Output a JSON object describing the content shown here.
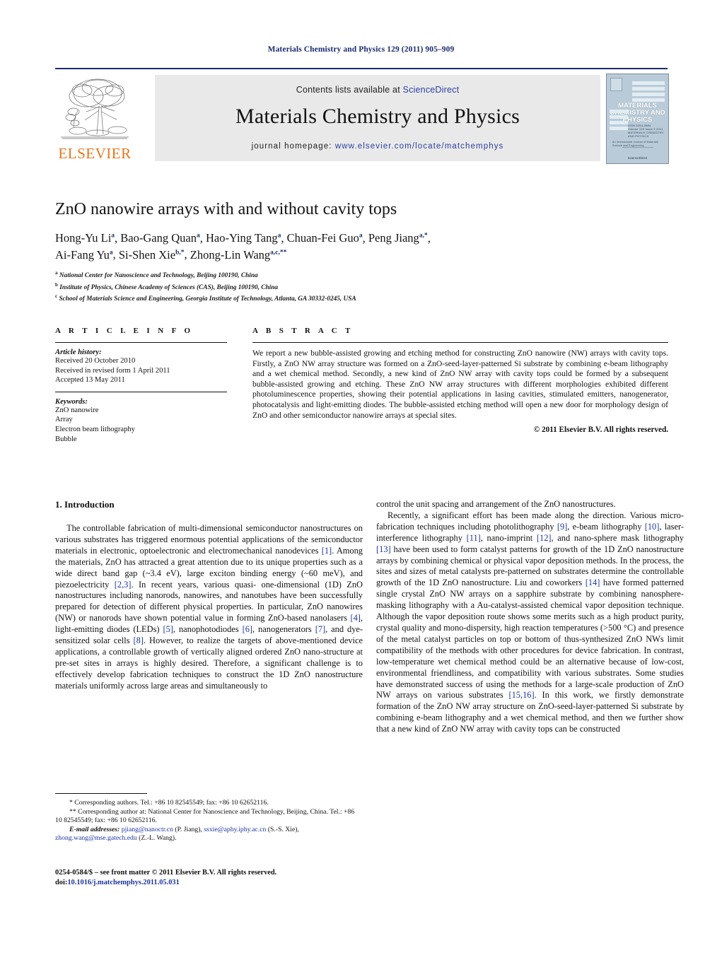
{
  "running_head": "Materials Chemistry and Physics 129 (2011) 905–909",
  "masthead": {
    "contents_prefix": "Contents lists available at ",
    "sciencedirect": "ScienceDirect",
    "journal_name": "Materials Chemistry and Physics",
    "homepage_prefix": "journal homepage: ",
    "homepage_url": "www.elsevier.com/locate/matchemphys",
    "publisher_wordmark": "ELSEVIER",
    "accent_link_color": "#2b3fa0",
    "elsevier_orange": "#E8761B",
    "rule_color": "#1c2b6b"
  },
  "cover": {
    "title_line1": "MATERIALS",
    "title_line2": "CHEMISTRY AND",
    "title_line3": "PHYSICS",
    "sub_line1": "ISSN 0254-0584",
    "sub_line2": "Volume 129 Issue 3 2011",
    "sub_line3": "MATERIALS CHEMISTRY",
    "sub_line4": "AND PHYSICS",
    "caption": "An International Journal of Materials Science and Engineering",
    "foot": "ScienceDirect",
    "background_color": "#b9cbd8"
  },
  "article": {
    "title": "ZnO nanowire arrays with and without cavity tops",
    "authors": [
      {
        "name": "Hong-Yu Li",
        "sup": "a",
        "sep": ", "
      },
      {
        "name": "Bao-Gang Quan",
        "sup": "a",
        "sep": ", "
      },
      {
        "name": "Hao-Ying Tang",
        "sup": "a",
        "sep": ", "
      },
      {
        "name": "Chuan-Fei Guo",
        "sup": "a",
        "sep": ", "
      },
      {
        "name": "Peng Jiang",
        "sup": "a,*",
        "sep": ","
      },
      {
        "name": "Ai-Fang Yu",
        "sup": "a",
        "sep": ", "
      },
      {
        "name": "Si-Shen Xie",
        "sup": "b,*",
        "sep": ", "
      },
      {
        "name": "Zhong-Lin Wang",
        "sup": "a,c,**",
        "sep": ""
      }
    ],
    "affiliations": [
      {
        "mark": "a",
        "text": "National Center for Nanoscience and Technology, Beijing 100190, China"
      },
      {
        "mark": "b",
        "text": "Institute of Physics, Chinese Academy of Sciences (CAS), Beijing 100190, China"
      },
      {
        "mark": "c",
        "text": "School of Materials Science and Engineering, Georgia Institute of Technology, Atlanta, GA 30332-0245, USA"
      }
    ]
  },
  "article_info": {
    "heading": "A R T I C L E   I N F O",
    "history_label": "Article history:",
    "history": [
      "Received 20 October 2010",
      "Received in revised form 1 April 2011",
      "Accepted 13 May 2011"
    ],
    "keywords_label": "Keywords:",
    "keywords": [
      "ZnO nanowire",
      "Array",
      "Electron beam lithography",
      "Bubble"
    ]
  },
  "abstract": {
    "heading": "A B S T R A C T",
    "text": "We report a new bubble-assisted growing and etching method for constructing ZnO nanowire (NW) arrays with cavity tops. Firstly, a ZnO NW array structure was formed on a ZnO-seed-layer-patterned Si substrate by combining e-beam lithography and a wet chemical method. Secondly, a new kind of ZnO NW array with cavity tops could be formed by a subsequent bubble-assisted growing and etching. These ZnO NW array structures with different morphologies exhibited different photoluminescence properties, showing their potential applications in lasing cavities, stimulated emitters, nanogenerator, photocatalysis and light-emitting diodes. The bubble-assisted etching method will open a new door for morphology design of ZnO and other semiconductor nanowire arrays at special sites.",
    "copyright": "© 2011 Elsevier B.V. All rights reserved."
  },
  "body": {
    "section_number_title": "1. Introduction",
    "left_par1_a": "The controllable fabrication of multi-dimensional semiconductor nanostructures on various substrates has triggered enormous potential applications of the semiconductor materials in electronic, optoelectronic and electromechanical nanodevices ",
    "left_ref1": "[1]",
    "left_par1_b": ". Among the materials, ZnO has attracted a great attention due to its unique properties such as a wide direct band gap (~3.4 eV), large exciton binding energy (~60 meV), and piezoelectricity ",
    "left_ref23": "[2,3]",
    "left_par1_c": ". In recent years, various quasi- one-dimensional (1D) ZnO nanostructures including nanorods, nanowires, and nanotubes have been successfully prepared for detection of different physical properties. In particular, ZnO nanowires (NW) or nanorods have shown potential value in forming ZnO-based nanolasers ",
    "left_ref4": "[4]",
    "left_par1_d": ", light-emitting diodes (LEDs) ",
    "left_ref5": "[5]",
    "left_par1_e": ", nanophotodiodes ",
    "left_ref6": "[6]",
    "left_par1_f": ", nanogenerators ",
    "left_ref7": "[7]",
    "left_par1_g": ", and dye-sensitized solar cells ",
    "left_ref8": "[8]",
    "left_par1_h": ". However, to realize the targets of above-mentioned device applications, a controllable growth of vertically aligned ordered ZnO nano-structure at pre-set sites in arrays is highly desired. Therefore, a significant challenge is to effectively develop fabrication techniques to construct the 1D ZnO nanostructure materials uniformly across large areas and simultaneously to",
    "right_par_cont": "control the unit spacing and arrangement of the ZnO nanostructures.",
    "right_par2_a": "Recently, a significant effort has been made along the direction. Various micro-fabrication techniques including photolithography ",
    "right_ref9": "[9]",
    "right_par2_b": ", e-beam lithography ",
    "right_ref10": "[10]",
    "right_par2_c": ", laser-interference lithography ",
    "right_ref11": "[11]",
    "right_par2_d": ", nano-imprint ",
    "right_ref12": "[12]",
    "right_par2_e": ", and nano-sphere mask lithography ",
    "right_ref13": "[13]",
    "right_par2_f": " have been used to form catalyst patterns for growth of the 1D ZnO nanostructure arrays by combining chemical or physical vapor deposition methods. In the process, the sites and sizes of metal catalysts pre-patterned on substrates determine the controllable growth of the 1D ZnO nanostructure. Liu and coworkers ",
    "right_ref14": "[14]",
    "right_par2_g": " have formed patterned single crystal ZnO NW arrays on a sapphire substrate by combining nanosphere-masking lithography with a Au-catalyst-assisted chemical vapor deposition technique. Although the vapor deposition route shows some merits such as a high product purity, crystal quality and mono-dispersity, high reaction temperatures (>500 °C) and presence of the metal catalyst particles on top or bottom of thus-synthesized ZnO NWs limit compatibility of the methods with other procedures for device fabrication. In contrast, low-temperature wet chemical method could be an alternative because of low-cost, environmental friendliness, and compatibility with various substrates. Some studies have demonstrated success of using the methods for a large-scale production of ZnO NW arrays on various substrates ",
    "right_ref1516": "[15,16]",
    "right_par2_h": ". In this work, we firstly demonstrate formation of the ZnO NW array structure on ZnO-seed-layer-patterned Si substrate by combining e-beam lithography and a wet chemical method, and then we further show that a new kind of ZnO NW array with cavity tops can be constructed"
  },
  "footnotes": {
    "line1": "* Corresponding authors. Tel.: +86 10 82545549; fax: +86 10 62652116.",
    "line2": "** Corresponding author at: National Center for Nanoscience and Technology, Beijing, China. Tel.: +86 10 82545549; fax: +86 10 62652116.",
    "email_label": "E-mail addresses:",
    "email1": "pjiang@nanoctr.cn",
    "email1_owner": " (P. Jiang), ",
    "email2": "ssxie@aphy.iphy.ac.cn",
    "email2_owner": " (S.-S. Xie), ",
    "email3": "zhong.wang@mse.gatech.edu",
    "email3_owner": " (Z.-L. Wang)."
  },
  "footer": {
    "issn_line": "0254-0584/$ – see front matter © 2011 Elsevier B.V. All rights reserved.",
    "doi_label": "doi:",
    "doi_value": "10.1016/j.matchemphys.2011.05.031"
  }
}
